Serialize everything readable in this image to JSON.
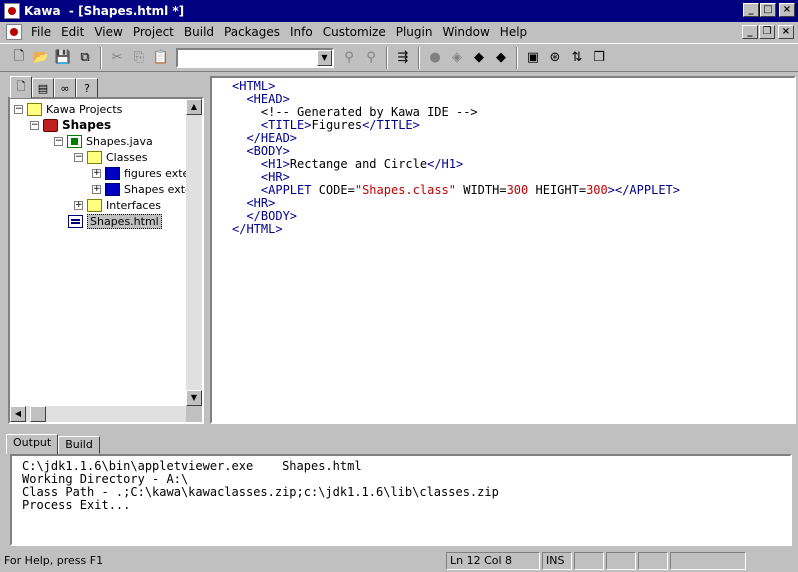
{
  "window": {
    "title": "Kawa  - [Shapes.html *]"
  },
  "menu": [
    "File",
    "Edit",
    "View",
    "Project",
    "Build",
    "Packages",
    "Info",
    "Customize",
    "Plugin",
    "Window",
    "Help"
  ],
  "toolbar": {
    "combo_value": ""
  },
  "left_tabs": [
    "files",
    "classes",
    "search",
    "help"
  ],
  "tree": {
    "root": "Kawa Projects",
    "project": "Shapes",
    "file1": "Shapes.java",
    "classes": "Classes",
    "class1": "figures extends",
    "class2": "Shapes extend",
    "interfaces": "Interfaces",
    "file2": "Shapes.html"
  },
  "code": {
    "lines": [
      "<HTML>",
      "<HEAD>",
      "<!-- Generated by Kawa IDE -->",
      "<TITLE>Figures</TITLE>",
      "</HEAD>",
      "<BODY>",
      "<H1>Rectange and Circle</H1>",
      "<HR>",
      "<APPLET CODE=\"Shapes.class\" WIDTH=300 HEIGHT=300></APPLET>",
      "<HR>",
      "</BODY>",
      "</HTML>"
    ]
  },
  "output": {
    "tabs": [
      "Output",
      "Build"
    ],
    "lines": [
      "C:\\jdk1.1.6\\bin\\appletviewer.exe    Shapes.html",
      "Working Directory - A:\\",
      "Class Path - .;C:\\kawa\\kawaclasses.zip;c:\\jdk1.1.6\\lib\\classes.zip",
      "Process Exit..."
    ]
  },
  "status": {
    "help": "For Help, press F1",
    "position": "Ln 12 Col 8",
    "ins": "INS"
  }
}
